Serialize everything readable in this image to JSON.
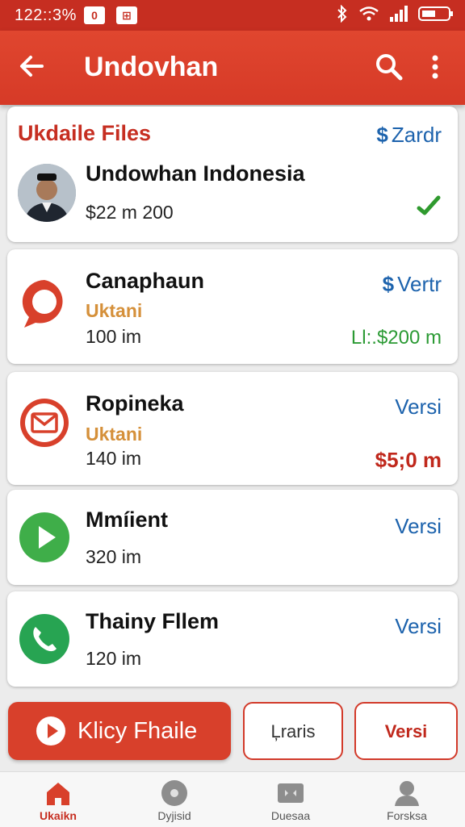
{
  "status_bar": {
    "time": "122::3%",
    "badge1": "0",
    "badge2": "⊞"
  },
  "app_bar": {
    "title": "Undovhan"
  },
  "section": {
    "title": "Ukdaile Files",
    "link_label": "Zardr"
  },
  "items": [
    {
      "name": "Undowhan Indonesia",
      "meta": "$22 m  200"
    },
    {
      "name": "Canaphaun",
      "subtitle": "Uktani",
      "meta": "100 im",
      "link_label": "Vertr",
      "price": "Ll:.$200 m"
    },
    {
      "name": "Ropineka",
      "subtitle": "Uktani",
      "meta": "140 im",
      "link_label": "Versi",
      "price": "$5;0 m"
    },
    {
      "name": "Mmíient",
      "meta": "320 im",
      "link_label": "Versi"
    },
    {
      "name": "Thainy Fllem",
      "meta": "120 im",
      "link_label": "Versi"
    }
  ],
  "actions": {
    "primary": "Klicy Fhaile",
    "secondary": "Ļraris",
    "tertiary": "Versi"
  },
  "bottom_nav": [
    {
      "label": "Ukaikn"
    },
    {
      "label": "Dyjisid"
    },
    {
      "label": "Duesaa"
    },
    {
      "label": "Forsksa"
    }
  ],
  "colors": {
    "brand_red": "#d63a27",
    "link_blue": "#1d63ad",
    "accent_orange": "#d5903a",
    "positive_green": "#2b9a34"
  }
}
